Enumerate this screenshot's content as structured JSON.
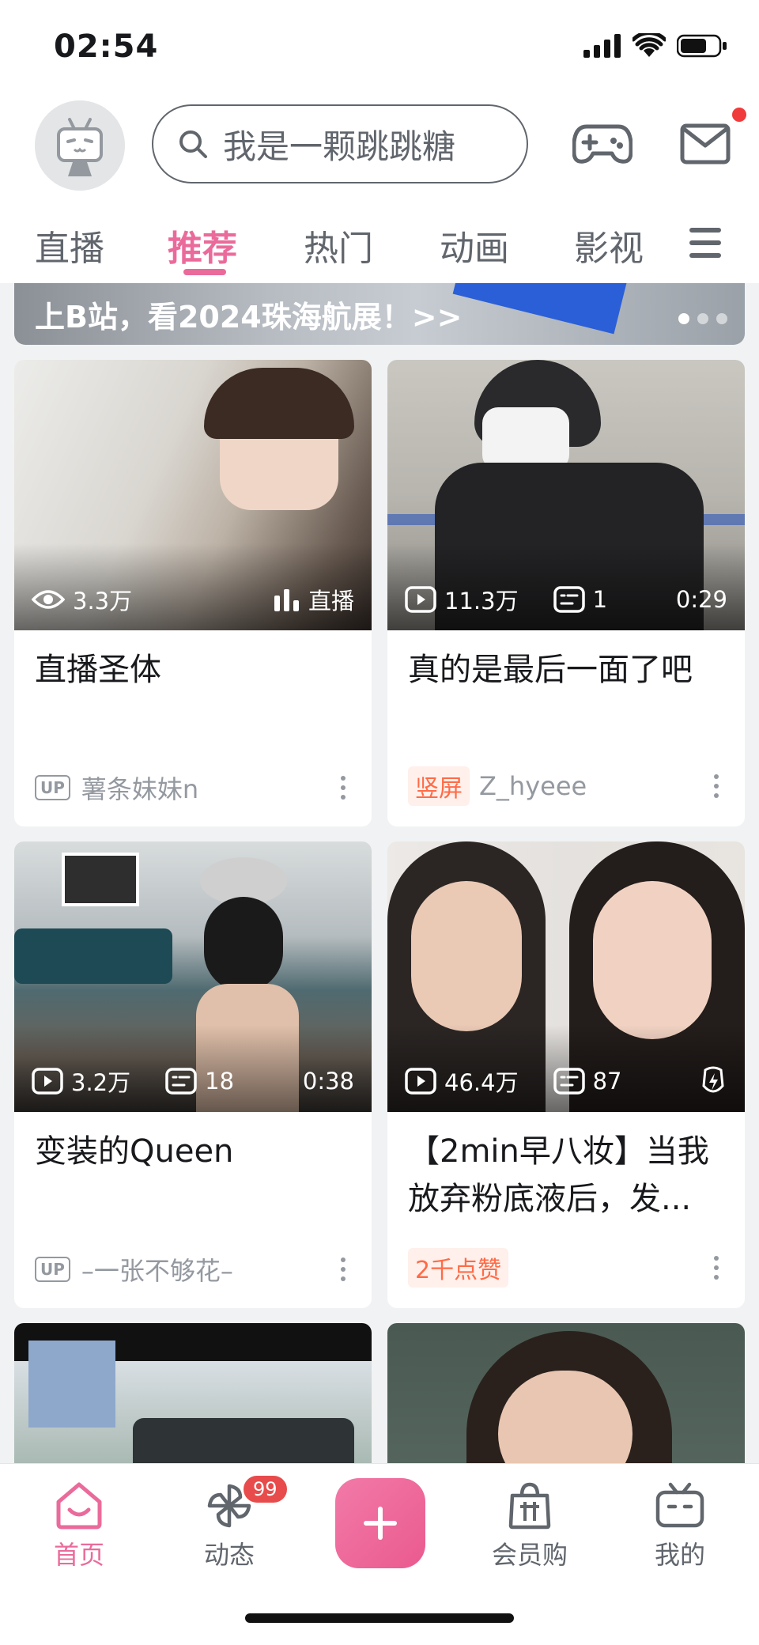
{
  "status_bar": {
    "time": "02:54"
  },
  "header": {
    "search_placeholder": "我是一颗跳跳糖"
  },
  "tabs": [
    {
      "label": "直播"
    },
    {
      "label": "推荐",
      "active": true
    },
    {
      "label": "热门"
    },
    {
      "label": "动画"
    },
    {
      "label": "影视"
    }
  ],
  "banner": {
    "text": "上B站，看2024珠海航展！>>",
    "dots": 3,
    "active_dot": 1
  },
  "cards": [
    {
      "views": "3.3万",
      "live_label": "直播",
      "title": "直播圣体",
      "author": "薯条妹妹n",
      "badge": "UP"
    },
    {
      "views": "11.3万",
      "comments": "1",
      "duration": "0:29",
      "title": "真的是最后一面了吧",
      "tag": "竖屏",
      "author": "Z_hyeee"
    },
    {
      "views": "3.2万",
      "comments": "18",
      "duration": "0:38",
      "title": "变装的Queen",
      "author": "–一张不够花–",
      "badge": "UP"
    },
    {
      "views": "46.4万",
      "comments": "87",
      "title": "【2min早八妆】当我放弃粉底液后，发...",
      "tag": "2千点赞"
    }
  ],
  "bottom_nav": [
    {
      "label": "首页",
      "icon": "home-icon",
      "active": true
    },
    {
      "label": "动态",
      "icon": "pinwheel-icon",
      "badge": "99"
    },
    {
      "label": "+",
      "icon": "plus-icon"
    },
    {
      "label": "会员购",
      "icon": "shopping-bag-icon"
    },
    {
      "label": "我的",
      "icon": "tv-icon"
    }
  ],
  "colors": {
    "accent": "#ea6b9b",
    "tag_orange": "#ff6b46",
    "badge_red": "#e84b4b"
  }
}
